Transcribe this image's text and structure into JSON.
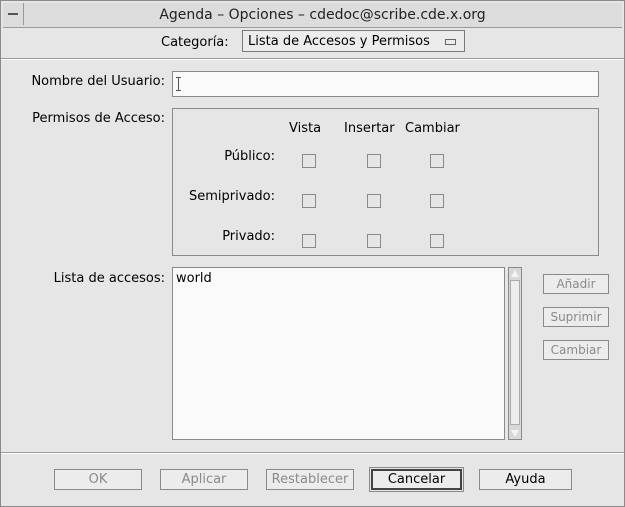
{
  "window": {
    "title": "Agenda –  Opciones – cdedoc@scribe.cde.x.org"
  },
  "category": {
    "label": "Categoría:",
    "value": "Lista de Accesos y Permisos"
  },
  "user_name": {
    "label": "Nombre del Usuario:",
    "value": ""
  },
  "permissions": {
    "label": "Permisos de Acceso:",
    "columns": [
      "Vista",
      "Insertar",
      "Cambiar"
    ],
    "rows": [
      {
        "label": "Público:",
        "values": [
          false,
          false,
          false
        ]
      },
      {
        "label": "Semiprivado:",
        "values": [
          false,
          false,
          false
        ]
      },
      {
        "label": "Privado:",
        "values": [
          false,
          false,
          false
        ]
      }
    ]
  },
  "access_list": {
    "label": "Lista de accesos:",
    "items": [
      "world"
    ]
  },
  "side_buttons": {
    "add": "Añadir",
    "delete": "Suprimir",
    "change": "Cambiar"
  },
  "footer": {
    "ok": "OK",
    "apply": "Aplicar",
    "reset": "Restablecer",
    "cancel": "Cancelar",
    "help": "Ayuda"
  }
}
